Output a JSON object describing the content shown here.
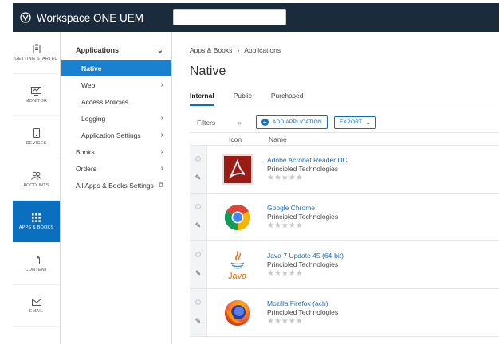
{
  "app": {
    "title": "Workspace ONE UEM",
    "search_value": ""
  },
  "leftnav": [
    {
      "label": "GETTING STARTED",
      "icon": "clipboard-icon"
    },
    {
      "label": "MONITOR",
      "icon": "monitor-icon"
    },
    {
      "label": "DEVICES",
      "icon": "phone-icon"
    },
    {
      "label": "ACCOUNTS",
      "icon": "users-icon"
    },
    {
      "label": "APPS & BOOKS",
      "icon": "grid-icon"
    },
    {
      "label": "CONTENT",
      "icon": "file-icon"
    },
    {
      "label": "EMAIL",
      "icon": "mail-icon"
    }
  ],
  "subnav": {
    "header": "Applications",
    "items": [
      "Native",
      "Web",
      "Access Policies",
      "Logging",
      "Application Settings"
    ],
    "top_items": [
      "Books",
      "Orders",
      "All Apps & Books Settings"
    ]
  },
  "breadcrumb": {
    "first": "Apps & Books",
    "second": "Applications"
  },
  "page_title": "Native",
  "tabs": [
    "Internal",
    "Public",
    "Purchased"
  ],
  "toolbar": {
    "filters": "Filters",
    "add": "ADD APPLICATION",
    "export": "EXPORT"
  },
  "columns": {
    "icon": "Icon",
    "name": "Name"
  },
  "apps": [
    {
      "name": "Adobe Acrobat Reader DC",
      "vendor": "Principled Technologies",
      "rating": "★★★★★"
    },
    {
      "name": "Google Chrome",
      "vendor": "Principled Technologies",
      "rating": "★★★★★"
    },
    {
      "name": "Java 7 Update 45 (64-bit)",
      "vendor": "Principled Technologies",
      "rating": "★★★★★"
    },
    {
      "name": "Mozilla Firefox (ach)",
      "vendor": "Principled Technologies",
      "rating": "★★★★★"
    }
  ],
  "java_logo_text": "Java"
}
